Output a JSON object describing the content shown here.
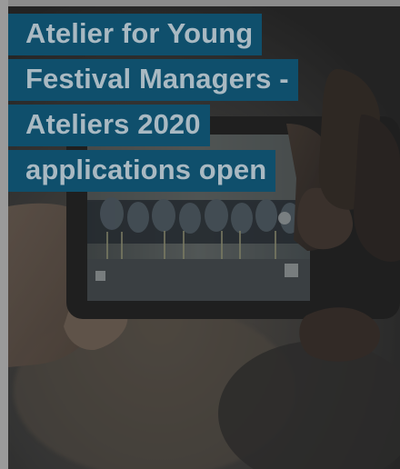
{
  "card": {
    "title": "Atelier for Young Festival Managers - Ateliers 2020 applications open"
  },
  "colors": {
    "title_background": "#0f4f6c",
    "title_text": "#a9b9c2",
    "photo_overlay": "#232323"
  },
  "photo": {
    "subject": "hands holding a smartphone filming a group"
  }
}
